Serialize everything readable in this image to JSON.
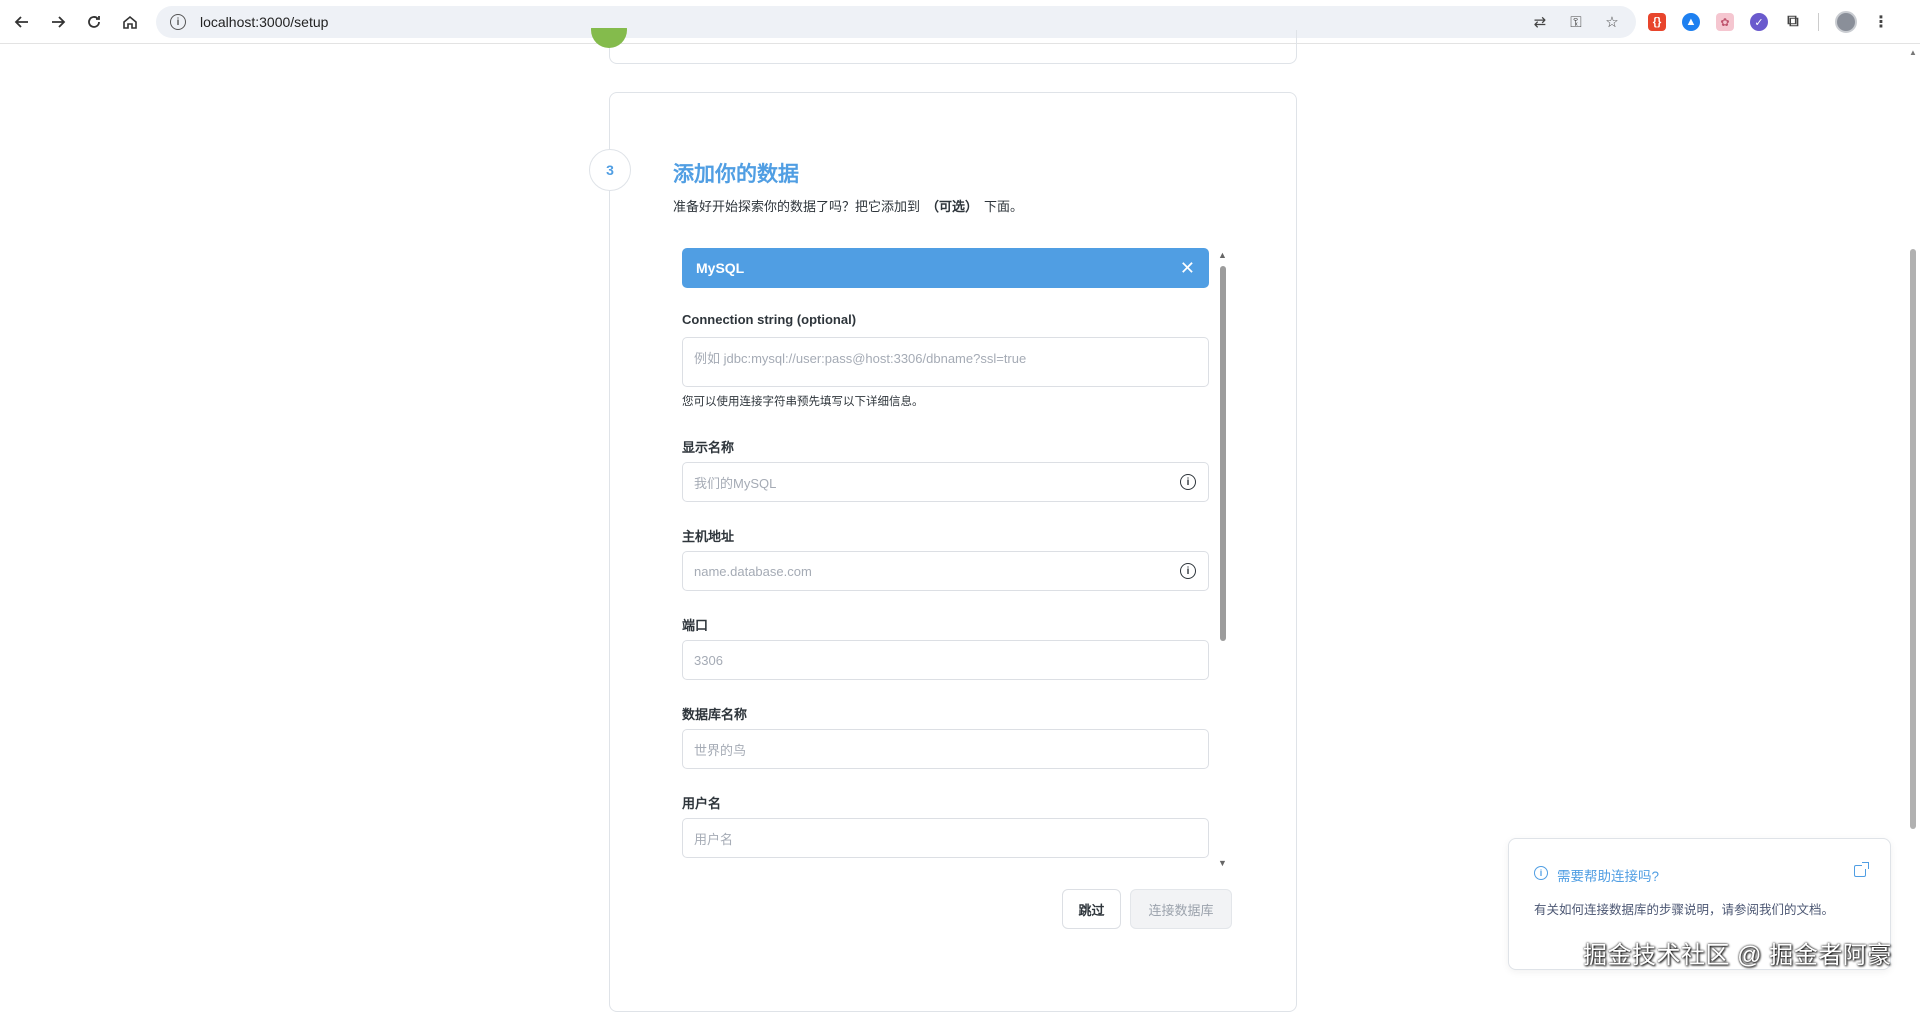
{
  "browser": {
    "url": "localhost:3000/setup"
  },
  "step": {
    "number": "3",
    "title": "添加你的数据",
    "subtitle_pre": "准备好开始探索你的数据了吗？把它添加到",
    "subtitle_bold": "（可选）",
    "subtitle_post": "下面。"
  },
  "database": {
    "engine": "MySQL",
    "close_symbol": "✕"
  },
  "form": {
    "connection_string": {
      "label": "Connection string (optional)",
      "placeholder": "例如 jdbc:mysql://user:pass@host:3306/dbname?ssl=true",
      "help": "您可以使用连接字符串预先填写以下详细信息。"
    },
    "display_name": {
      "label": "显示名称",
      "placeholder": "我们的MySQL"
    },
    "host": {
      "label": "主机地址",
      "placeholder": "name.database.com"
    },
    "port": {
      "label": "端口",
      "placeholder": "3306"
    },
    "db_name": {
      "label": "数据库名称",
      "placeholder": "世界的鸟"
    },
    "username": {
      "label": "用户名",
      "placeholder": "用户名"
    }
  },
  "buttons": {
    "skip": "跳过",
    "connect": "连接数据库"
  },
  "help_popup": {
    "title": "需要帮助连接吗?",
    "text": "有关如何连接数据库的步骤说明，请参阅我们的文档。"
  },
  "watermark": "掘金技术社区 @ 掘金者阿豪",
  "colors": {
    "brand": "#509ee3",
    "success": "#84bb4c"
  }
}
